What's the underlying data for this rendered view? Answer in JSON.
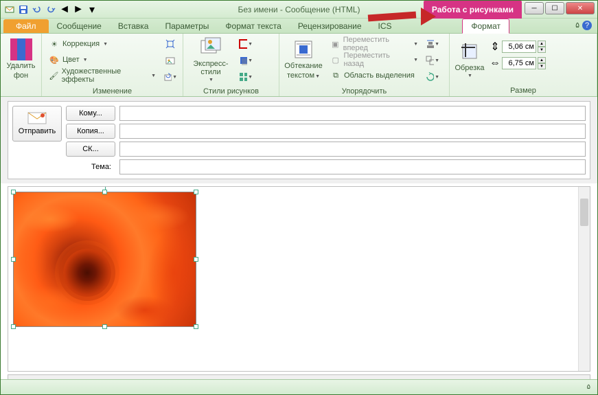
{
  "title": "Без имени  -  Сообщение (HTML)",
  "context_title": "Работа с рисунками",
  "context_tab": "Формат",
  "tabs": {
    "file": "Файл",
    "message": "Сообщение",
    "insert": "Вставка",
    "options": "Параметры",
    "format_text": "Формат текста",
    "review": "Рецензирование",
    "ics": "ICS"
  },
  "ribbon": {
    "remove_bg": {
      "label1": "Удалить",
      "label2": "фон"
    },
    "adjust": {
      "group": "Изменение",
      "corrections": "Коррекция",
      "color": "Цвет",
      "artistic": "Художественные эффекты"
    },
    "styles": {
      "express": "Экспресс-стили",
      "group": "Стили рисунков"
    },
    "wrap": {
      "label1": "Обтекание",
      "label2": "текстом"
    },
    "arrange": {
      "group": "Упорядочить",
      "bring_fwd": "Переместить вперед",
      "send_back": "Переместить назад",
      "selection_pane": "Область выделения"
    },
    "crop": {
      "label": "Обрезка"
    },
    "size": {
      "group": "Размер",
      "height": "5,06 см",
      "width": "6,75 см"
    }
  },
  "msg": {
    "send": "Отправить",
    "to": "Кому...",
    "cc": "Копия...",
    "bcc": "СК...",
    "subject": "Тема:"
  }
}
